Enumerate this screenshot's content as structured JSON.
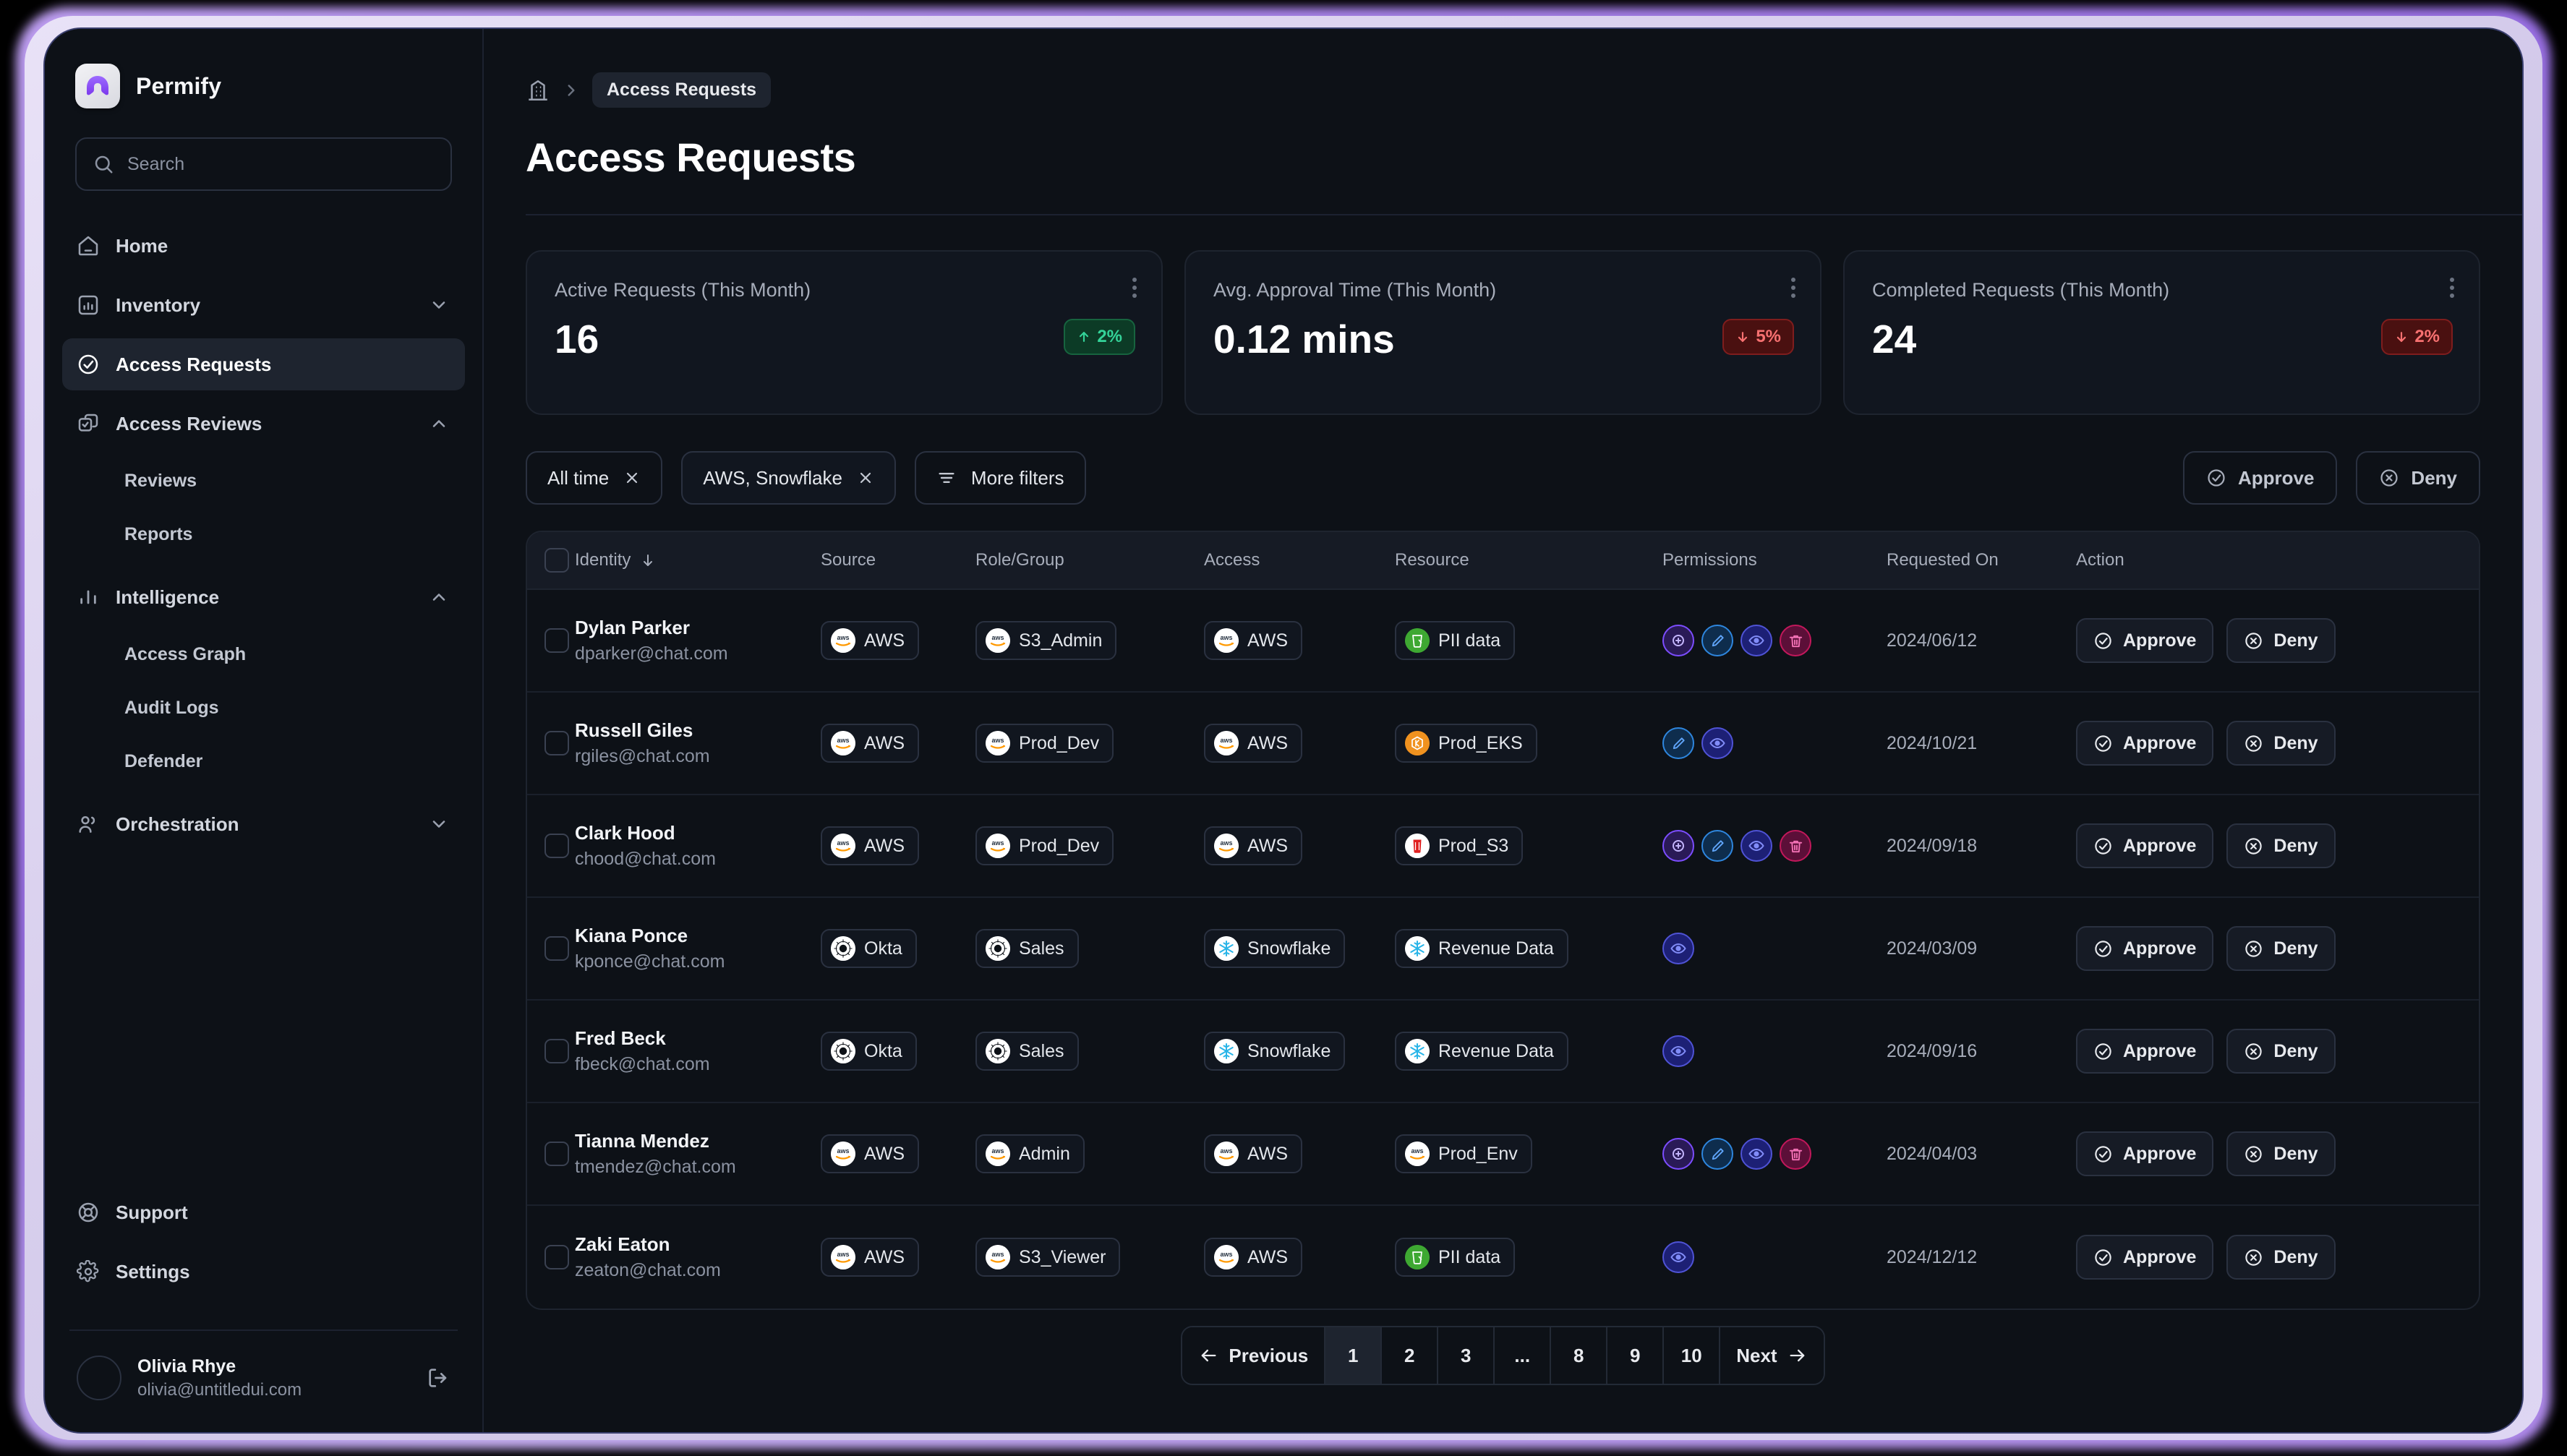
{
  "brand": {
    "name": "Permify",
    "logo_icon": "permify-logo-icon"
  },
  "search": {
    "placeholder": "Search",
    "icon": "search-icon"
  },
  "sidebar": {
    "items": [
      {
        "label": "Home",
        "icon": "home-icon",
        "type": "item",
        "state": "default"
      },
      {
        "label": "Inventory",
        "icon": "inventory-icon",
        "type": "group",
        "chevron": "chevron-down-icon"
      },
      {
        "label": "Access Requests",
        "icon": "check-circle-icon",
        "type": "item",
        "state": "active"
      },
      {
        "label": "Access Reviews",
        "icon": "copy-check-icon",
        "type": "group",
        "chevron": "chevron-up-icon"
      },
      {
        "label": "Reviews",
        "type": "sub"
      },
      {
        "label": "Reports",
        "type": "sub"
      },
      {
        "label": "Intelligence",
        "icon": "bar-chart-icon",
        "type": "group",
        "chevron": "chevron-up-icon"
      },
      {
        "label": "Access Graph",
        "type": "sub"
      },
      {
        "label": "Audit Logs",
        "type": "sub"
      },
      {
        "label": "Defender",
        "type": "sub"
      },
      {
        "label": "Orchestration",
        "icon": "users-icon",
        "type": "group",
        "chevron": "chevron-down-icon"
      }
    ],
    "bottom_items": [
      {
        "label": "Support",
        "icon": "lifebuoy-icon"
      },
      {
        "label": "Settings",
        "icon": "gear-icon"
      }
    ],
    "user": {
      "name": "Olivia Rhye",
      "email": "olivia@untitledui.com",
      "logout_icon": "logout-icon"
    }
  },
  "header": {
    "breadcrumb_home_icon": "building-icon",
    "breadcrumb_separator": "chevron-right-icon",
    "breadcrumb_current": "Access Requests",
    "title": "Access Requests"
  },
  "stats": [
    {
      "label": "Active Requests (This Month)",
      "value": "16",
      "delta": "2%",
      "direction": "up",
      "color": "#34d399"
    },
    {
      "label": "Avg. Approval Time (This Month)",
      "value": "0.12 mins",
      "delta": "5%",
      "direction": "down",
      "color": "#f87171"
    },
    {
      "label": "Completed Requests (This Month)",
      "value": "24",
      "delta": "2%",
      "direction": "down",
      "color": "#f87171"
    }
  ],
  "filters": {
    "chips": [
      {
        "label": "All time",
        "remove_icon": "close-icon"
      },
      {
        "label": "AWS, Snowflake",
        "remove_icon": "close-icon"
      }
    ],
    "more_filters": {
      "label": "More filters",
      "icon": "filter-lines-icon"
    },
    "bulk_approve": {
      "label": "Approve",
      "icon": "check-circle-icon"
    },
    "bulk_deny": {
      "label": "Deny",
      "icon": "x-circle-icon"
    }
  },
  "table": {
    "columns": [
      "Identity",
      "Source",
      "Role/Group",
      "Access",
      "Resource",
      "Permissions",
      "Requested On",
      "Action"
    ],
    "sort_icon": "arrow-down-icon",
    "row_action_approve": "Approve",
    "row_action_deny": "Deny",
    "rows": [
      {
        "name": "Dylan Parker",
        "email": "dparker@chat.com",
        "source": "AWS",
        "source_logo": "aws-logo",
        "role": "S3_Admin",
        "role_logo": "aws-logo",
        "access": "AWS",
        "access_logo": "aws-logo",
        "resource": "PII data",
        "resource_logo": "bucket-green-logo",
        "permissions": [
          "add",
          "edit",
          "view",
          "delete"
        ],
        "requested_on": "2024/06/12"
      },
      {
        "name": "Russell Giles",
        "email": "rgiles@chat.com",
        "source": "AWS",
        "source_logo": "aws-logo",
        "role": "Prod_Dev",
        "role_logo": "aws-logo",
        "access": "AWS",
        "access_logo": "aws-logo",
        "resource": "Prod_EKS",
        "resource_logo": "eks-orange-logo",
        "permissions": [
          "edit",
          "view"
        ],
        "requested_on": "2024/10/21"
      },
      {
        "name": "Clark Hood",
        "email": "chood@chat.com",
        "source": "AWS",
        "source_logo": "aws-logo",
        "role": "Prod_Dev",
        "role_logo": "aws-logo",
        "access": "AWS",
        "access_logo": "aws-logo",
        "resource": "Prod_S3",
        "resource_logo": "s3-red-logo",
        "permissions": [
          "add",
          "edit",
          "view",
          "delete"
        ],
        "requested_on": "2024/09/18"
      },
      {
        "name": "Kiana Ponce",
        "email": "kponce@chat.com",
        "source": "Okta",
        "source_logo": "okta-logo",
        "role": "Sales",
        "role_logo": "okta-logo",
        "access": "Snowflake",
        "access_logo": "snowflake-logo",
        "resource": "Revenue Data",
        "resource_logo": "snowflake-logo",
        "permissions": [
          "view"
        ],
        "requested_on": "2024/03/09"
      },
      {
        "name": "Fred Beck",
        "email": "fbeck@chat.com",
        "source": "Okta",
        "source_logo": "okta-logo",
        "role": "Sales",
        "role_logo": "okta-logo",
        "access": "Snowflake",
        "access_logo": "snowflake-logo",
        "resource": "Revenue Data",
        "resource_logo": "snowflake-logo",
        "permissions": [
          "view"
        ],
        "requested_on": "2024/09/16"
      },
      {
        "name": "Tianna Mendez",
        "email": "tmendez@chat.com",
        "source": "AWS",
        "source_logo": "aws-logo",
        "role": "Admin",
        "role_logo": "aws-logo",
        "access": "AWS",
        "access_logo": "aws-logo",
        "resource": "Prod_Env",
        "resource_logo": "aws-logo",
        "permissions": [
          "add",
          "edit",
          "view",
          "delete"
        ],
        "requested_on": "2024/04/03"
      },
      {
        "name": "Zaki Eaton",
        "email": "zeaton@chat.com",
        "source": "AWS",
        "source_logo": "aws-logo",
        "role": "S3_Viewer",
        "role_logo": "aws-logo",
        "access": "AWS",
        "access_logo": "aws-logo",
        "resource": "PII data",
        "resource_logo": "bucket-green-logo",
        "permissions": [
          "view"
        ],
        "requested_on": "2024/12/12"
      }
    ]
  },
  "pagination": {
    "previous": "Previous",
    "next": "Next",
    "pages": [
      "1",
      "2",
      "3",
      "...",
      "8",
      "9",
      "10"
    ],
    "current": "1",
    "prev_icon": "arrow-left-icon",
    "next_icon": "arrow-right-icon"
  }
}
